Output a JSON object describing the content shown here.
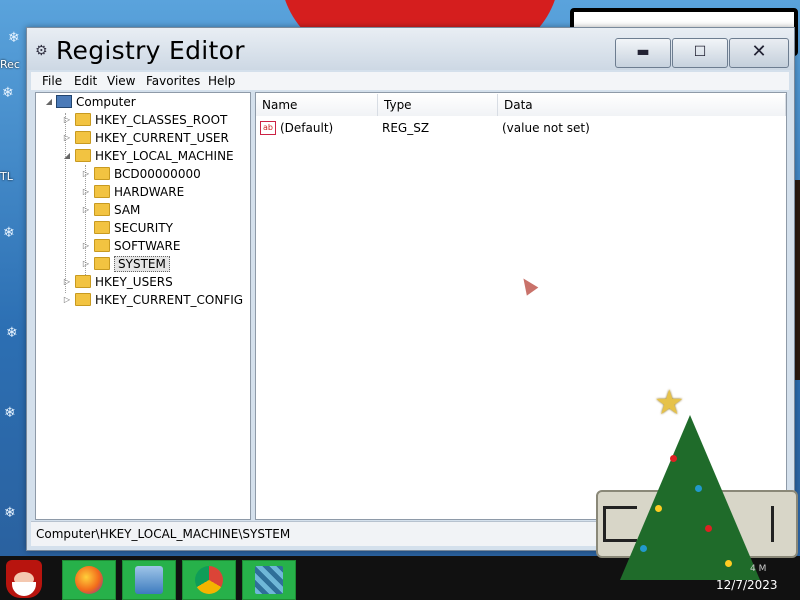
{
  "window": {
    "title": "Registry Editor",
    "controls": {
      "minimize": "▬",
      "maximize": "☐",
      "close": "✕"
    }
  },
  "menu": [
    "File",
    "Edit",
    "View",
    "Favorites",
    "Help"
  ],
  "tree": [
    {
      "label": "Computer",
      "level": 0,
      "expanded": true
    },
    {
      "label": "HKEY_CLASSES_ROOT",
      "level": 1
    },
    {
      "label": "HKEY_CURRENT_USER",
      "level": 1
    },
    {
      "label": "HKEY_LOCAL_MACHINE",
      "level": 1,
      "expanded": true
    },
    {
      "label": "BCD00000000",
      "level": 2
    },
    {
      "label": "HARDWARE",
      "level": 2
    },
    {
      "label": "SAM",
      "level": 2
    },
    {
      "label": "SECURITY",
      "level": 2
    },
    {
      "label": "SOFTWARE",
      "level": 2
    },
    {
      "label": "SYSTEM",
      "level": 2,
      "selected": true
    },
    {
      "label": "HKEY_USERS",
      "level": 1
    },
    {
      "label": "HKEY_CURRENT_CONFIG",
      "level": 1
    }
  ],
  "list": {
    "columns": [
      "Name",
      "Type",
      "Data"
    ],
    "rows": [
      {
        "name": "(Default)",
        "type": "REG_SZ",
        "data": "(value not set)",
        "icon": "ab"
      }
    ]
  },
  "status_path": "Computer\\HKEY_LOCAL_MACHINE\\SYSTEM",
  "desktop": {
    "icon_labels": [
      "Rec",
      "TL"
    ]
  },
  "taskbar": {
    "clock_date": "12/7/2023",
    "clock_time": "4 M"
  },
  "colors": {
    "window_chrome": "#d4e0ec",
    "folder": "#f2c341",
    "taskbar_button": "#27b14a",
    "santa_red": "#d51e1e"
  },
  "icons": {
    "app": "registry-icon",
    "computer": "computer-icon",
    "folder": "folder-icon",
    "value": "string-value-icon"
  }
}
